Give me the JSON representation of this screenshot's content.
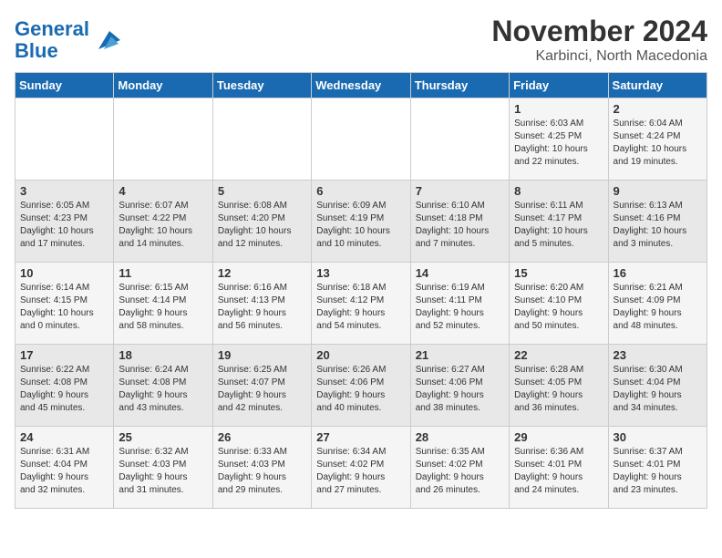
{
  "logo": {
    "line1": "General",
    "line2": "Blue"
  },
  "title": "November 2024",
  "subtitle": "Karbinci, North Macedonia",
  "days_of_week": [
    "Sunday",
    "Monday",
    "Tuesday",
    "Wednesday",
    "Thursday",
    "Friday",
    "Saturday"
  ],
  "weeks": [
    [
      {
        "day": "",
        "content": ""
      },
      {
        "day": "",
        "content": ""
      },
      {
        "day": "",
        "content": ""
      },
      {
        "day": "",
        "content": ""
      },
      {
        "day": "",
        "content": ""
      },
      {
        "day": "1",
        "content": "Sunrise: 6:03 AM\nSunset: 4:25 PM\nDaylight: 10 hours\nand 22 minutes."
      },
      {
        "day": "2",
        "content": "Sunrise: 6:04 AM\nSunset: 4:24 PM\nDaylight: 10 hours\nand 19 minutes."
      }
    ],
    [
      {
        "day": "3",
        "content": "Sunrise: 6:05 AM\nSunset: 4:23 PM\nDaylight: 10 hours\nand 17 minutes."
      },
      {
        "day": "4",
        "content": "Sunrise: 6:07 AM\nSunset: 4:22 PM\nDaylight: 10 hours\nand 14 minutes."
      },
      {
        "day": "5",
        "content": "Sunrise: 6:08 AM\nSunset: 4:20 PM\nDaylight: 10 hours\nand 12 minutes."
      },
      {
        "day": "6",
        "content": "Sunrise: 6:09 AM\nSunset: 4:19 PM\nDaylight: 10 hours\nand 10 minutes."
      },
      {
        "day": "7",
        "content": "Sunrise: 6:10 AM\nSunset: 4:18 PM\nDaylight: 10 hours\nand 7 minutes."
      },
      {
        "day": "8",
        "content": "Sunrise: 6:11 AM\nSunset: 4:17 PM\nDaylight: 10 hours\nand 5 minutes."
      },
      {
        "day": "9",
        "content": "Sunrise: 6:13 AM\nSunset: 4:16 PM\nDaylight: 10 hours\nand 3 minutes."
      }
    ],
    [
      {
        "day": "10",
        "content": "Sunrise: 6:14 AM\nSunset: 4:15 PM\nDaylight: 10 hours\nand 0 minutes."
      },
      {
        "day": "11",
        "content": "Sunrise: 6:15 AM\nSunset: 4:14 PM\nDaylight: 9 hours\nand 58 minutes."
      },
      {
        "day": "12",
        "content": "Sunrise: 6:16 AM\nSunset: 4:13 PM\nDaylight: 9 hours\nand 56 minutes."
      },
      {
        "day": "13",
        "content": "Sunrise: 6:18 AM\nSunset: 4:12 PM\nDaylight: 9 hours\nand 54 minutes."
      },
      {
        "day": "14",
        "content": "Sunrise: 6:19 AM\nSunset: 4:11 PM\nDaylight: 9 hours\nand 52 minutes."
      },
      {
        "day": "15",
        "content": "Sunrise: 6:20 AM\nSunset: 4:10 PM\nDaylight: 9 hours\nand 50 minutes."
      },
      {
        "day": "16",
        "content": "Sunrise: 6:21 AM\nSunset: 4:09 PM\nDaylight: 9 hours\nand 48 minutes."
      }
    ],
    [
      {
        "day": "17",
        "content": "Sunrise: 6:22 AM\nSunset: 4:08 PM\nDaylight: 9 hours\nand 45 minutes."
      },
      {
        "day": "18",
        "content": "Sunrise: 6:24 AM\nSunset: 4:08 PM\nDaylight: 9 hours\nand 43 minutes."
      },
      {
        "day": "19",
        "content": "Sunrise: 6:25 AM\nSunset: 4:07 PM\nDaylight: 9 hours\nand 42 minutes."
      },
      {
        "day": "20",
        "content": "Sunrise: 6:26 AM\nSunset: 4:06 PM\nDaylight: 9 hours\nand 40 minutes."
      },
      {
        "day": "21",
        "content": "Sunrise: 6:27 AM\nSunset: 4:06 PM\nDaylight: 9 hours\nand 38 minutes."
      },
      {
        "day": "22",
        "content": "Sunrise: 6:28 AM\nSunset: 4:05 PM\nDaylight: 9 hours\nand 36 minutes."
      },
      {
        "day": "23",
        "content": "Sunrise: 6:30 AM\nSunset: 4:04 PM\nDaylight: 9 hours\nand 34 minutes."
      }
    ],
    [
      {
        "day": "24",
        "content": "Sunrise: 6:31 AM\nSunset: 4:04 PM\nDaylight: 9 hours\nand 32 minutes."
      },
      {
        "day": "25",
        "content": "Sunrise: 6:32 AM\nSunset: 4:03 PM\nDaylight: 9 hours\nand 31 minutes."
      },
      {
        "day": "26",
        "content": "Sunrise: 6:33 AM\nSunset: 4:03 PM\nDaylight: 9 hours\nand 29 minutes."
      },
      {
        "day": "27",
        "content": "Sunrise: 6:34 AM\nSunset: 4:02 PM\nDaylight: 9 hours\nand 27 minutes."
      },
      {
        "day": "28",
        "content": "Sunrise: 6:35 AM\nSunset: 4:02 PM\nDaylight: 9 hours\nand 26 minutes."
      },
      {
        "day": "29",
        "content": "Sunrise: 6:36 AM\nSunset: 4:01 PM\nDaylight: 9 hours\nand 24 minutes."
      },
      {
        "day": "30",
        "content": "Sunrise: 6:37 AM\nSunset: 4:01 PM\nDaylight: 9 hours\nand 23 minutes."
      }
    ]
  ]
}
